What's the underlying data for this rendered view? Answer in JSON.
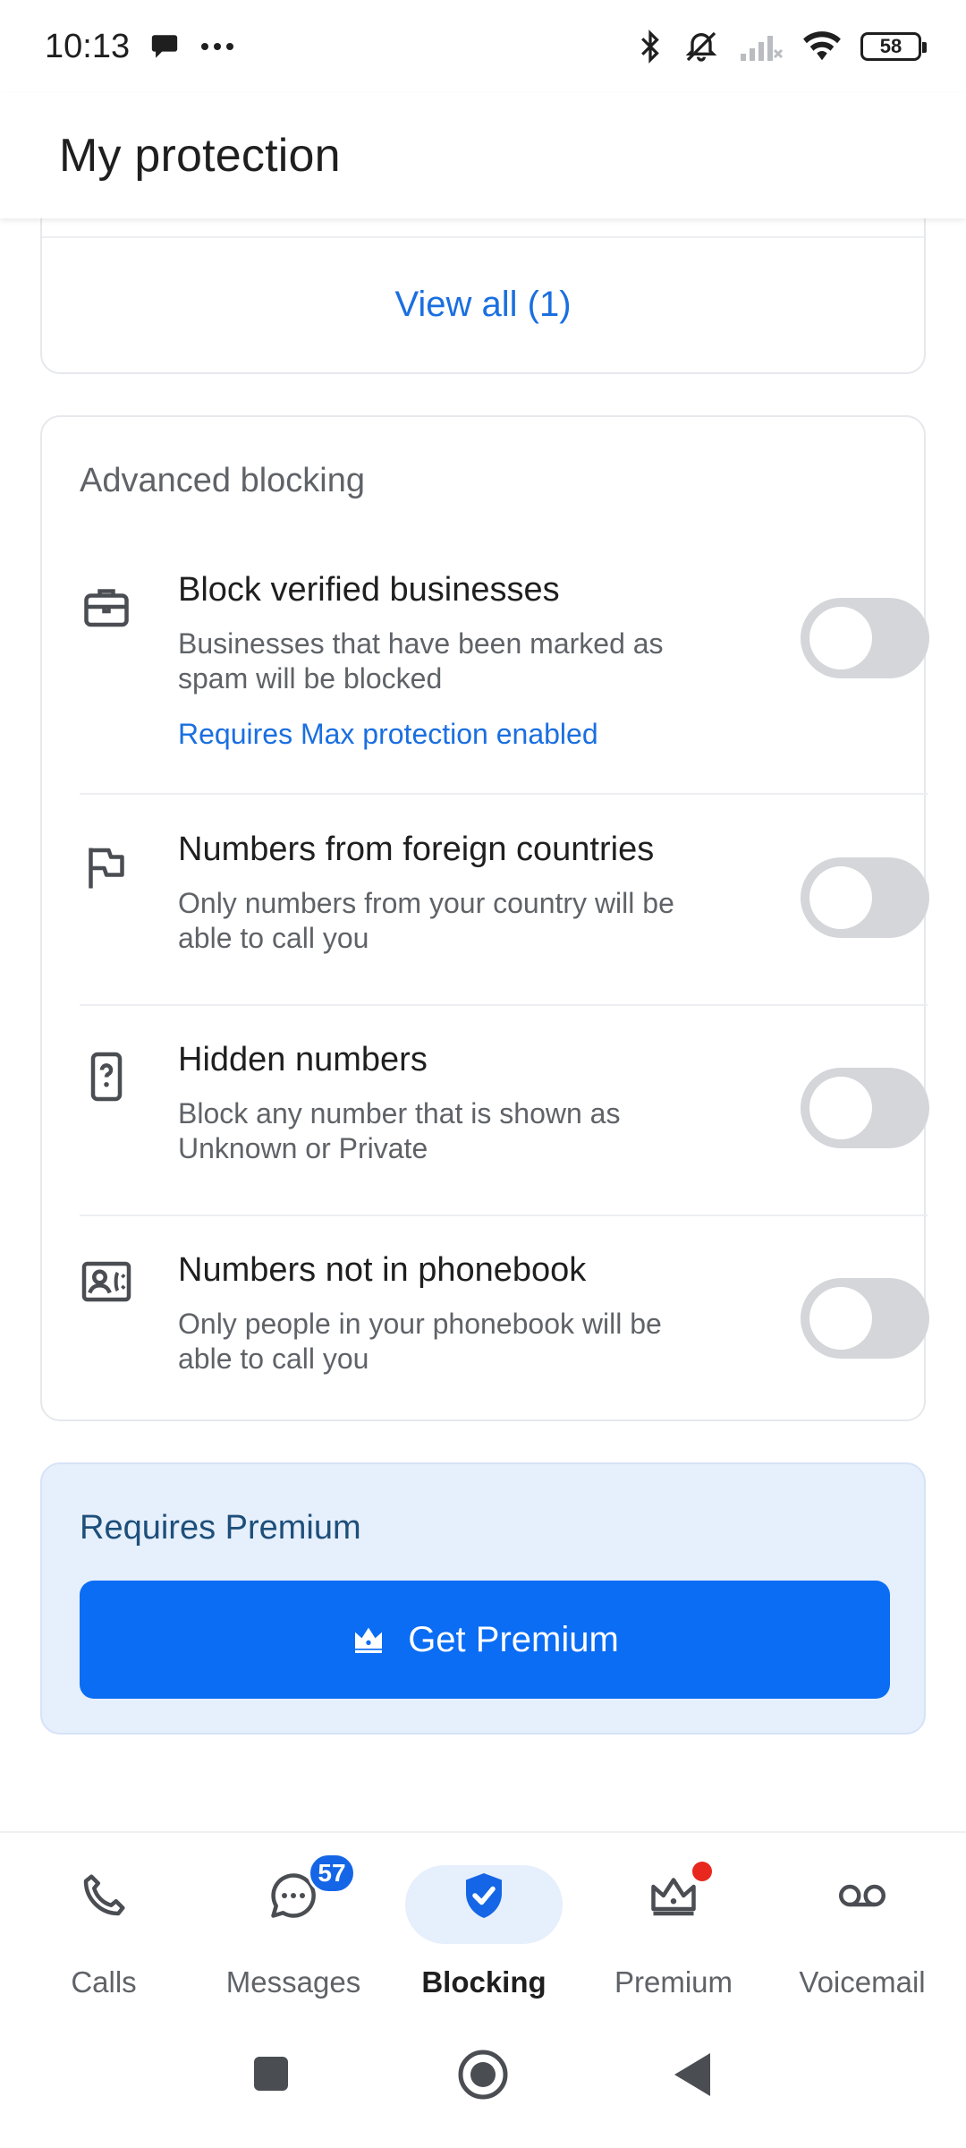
{
  "status_bar": {
    "time": "10:13",
    "battery_level": "58",
    "icons": [
      "chat-bubble-icon",
      "more-dots-icon",
      "bluetooth-icon",
      "alarm-off-icon",
      "signal-icon",
      "wifi-icon",
      "battery-icon"
    ]
  },
  "header": {
    "title": "My protection"
  },
  "top_card": {
    "view_all_label": "View all (1)"
  },
  "advanced": {
    "title": "Advanced blocking",
    "items": [
      {
        "icon": "briefcase-icon",
        "title": "Block verified businesses",
        "desc_line1": "Businesses that have been marked as",
        "desc_line2": "spam will be blocked",
        "link": "Requires Max protection enabled",
        "enabled": false
      },
      {
        "icon": "flag-icon",
        "title": "Numbers from foreign countries",
        "desc_line1": "Only numbers from your country will be",
        "desc_line2": "able to call you",
        "enabled": false
      },
      {
        "icon": "phone-question-icon",
        "title": "Hidden numbers",
        "desc_line1": "Block any number that is shown as",
        "desc_line2": "Unknown or Private",
        "enabled": false
      },
      {
        "icon": "contact-card-icon",
        "title": "Numbers not in phonebook",
        "desc_line1": "Only people in your phonebook will be",
        "desc_line2": "able to call you",
        "enabled": false
      }
    ]
  },
  "premium_card": {
    "title": "Requires Premium",
    "button_label": "Get Premium",
    "button_icon": "crown-icon"
  },
  "bottom_nav": {
    "items": [
      {
        "label": "Calls",
        "icon": "phone-icon"
      },
      {
        "label": "Messages",
        "icon": "message-icon",
        "badge": "57"
      },
      {
        "label": "Blocking",
        "icon": "shield-check-icon",
        "active": true
      },
      {
        "label": "Premium",
        "icon": "crown-icon"
      },
      {
        "label": "Voicemail",
        "icon": "voicemail-icon"
      }
    ]
  },
  "colors": {
    "accent": "#0b6cf4",
    "link": "#1a6fe0",
    "toggle_off": "#d4d6da",
    "premium_bg": "#e6effc",
    "badge": "#1466e6",
    "notification_dot": "#e8281e"
  }
}
